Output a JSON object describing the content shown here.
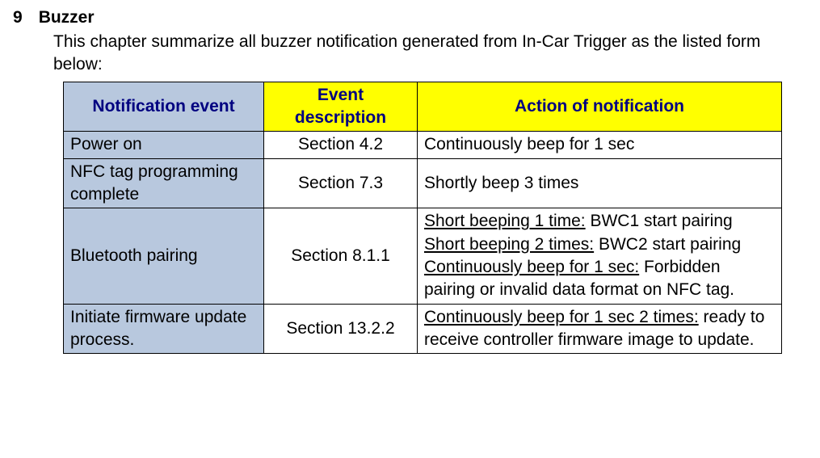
{
  "section": {
    "number": "9",
    "title": "Buzzer"
  },
  "intro": "This chapter summarize all buzzer notification generated from In-Car Trigger as the listed form below:",
  "table": {
    "headers": {
      "event": "Notification event",
      "desc": "Event description",
      "action": "Action of notification"
    },
    "rows": [
      {
        "event": "Power on",
        "desc": "Section 4.2",
        "action_plain": "Continuously beep for 1 sec"
      },
      {
        "event": "NFC tag programming complete",
        "desc": "Section 7.3",
        "action_plain": "Shortly beep 3 times"
      },
      {
        "event": "Bluetooth pairing",
        "desc": "Section 8.1.1",
        "bt": {
          "u1": "Short beeping 1 time:",
          "t1": " BWC1 start pairing",
          "u2": "Short beeping 2 times:",
          "t2": " BWC2 start pairing",
          "u3": "Continuously beep for 1 sec:",
          "t3": " Forbidden pairing or invalid data format on NFC tag."
        }
      },
      {
        "event": "Initiate firmware update process.",
        "desc": "Section 13.2.2",
        "fw": {
          "u": "Continuously beep for 1 sec 2 times:",
          "t": " ready to receive controller firmware image to update."
        }
      }
    ]
  }
}
